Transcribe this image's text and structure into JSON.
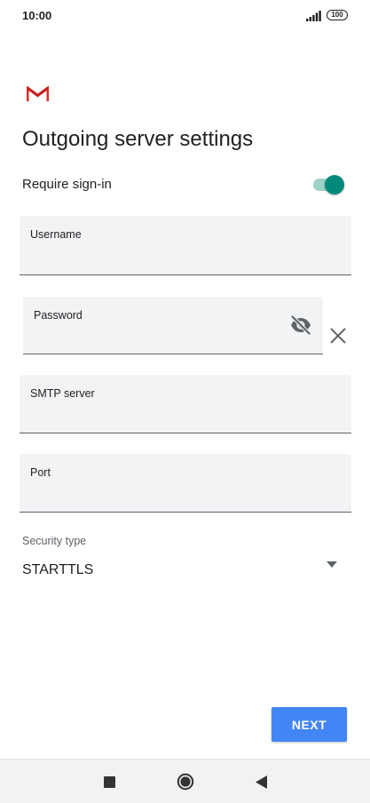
{
  "status_bar": {
    "time": "10:00",
    "battery": "100",
    "icons": [
      "signal-icon",
      "battery-icon"
    ]
  },
  "app": {
    "logo": "gmail-logo"
  },
  "page": {
    "title": "Outgoing server settings"
  },
  "require_signin": {
    "label": "Require sign-in",
    "enabled": true,
    "colors": {
      "thumb": "#00897b",
      "track": "#9fd1c9"
    }
  },
  "fields": {
    "username": {
      "label": "Username",
      "value": ""
    },
    "password": {
      "label": "Password",
      "value": "",
      "icons": [
        "visibility-off-icon",
        "clear-icon"
      ]
    },
    "smtp_server": {
      "label": "SMTP server",
      "value": ""
    },
    "port": {
      "label": "Port",
      "value": ""
    }
  },
  "security": {
    "label": "Security type",
    "selected": "STARTTLS"
  },
  "actions": {
    "next_label": "NEXT",
    "next_color": "#4285f4"
  },
  "nav": {
    "icons": [
      "recents-icon",
      "home-icon",
      "back-icon"
    ]
  }
}
